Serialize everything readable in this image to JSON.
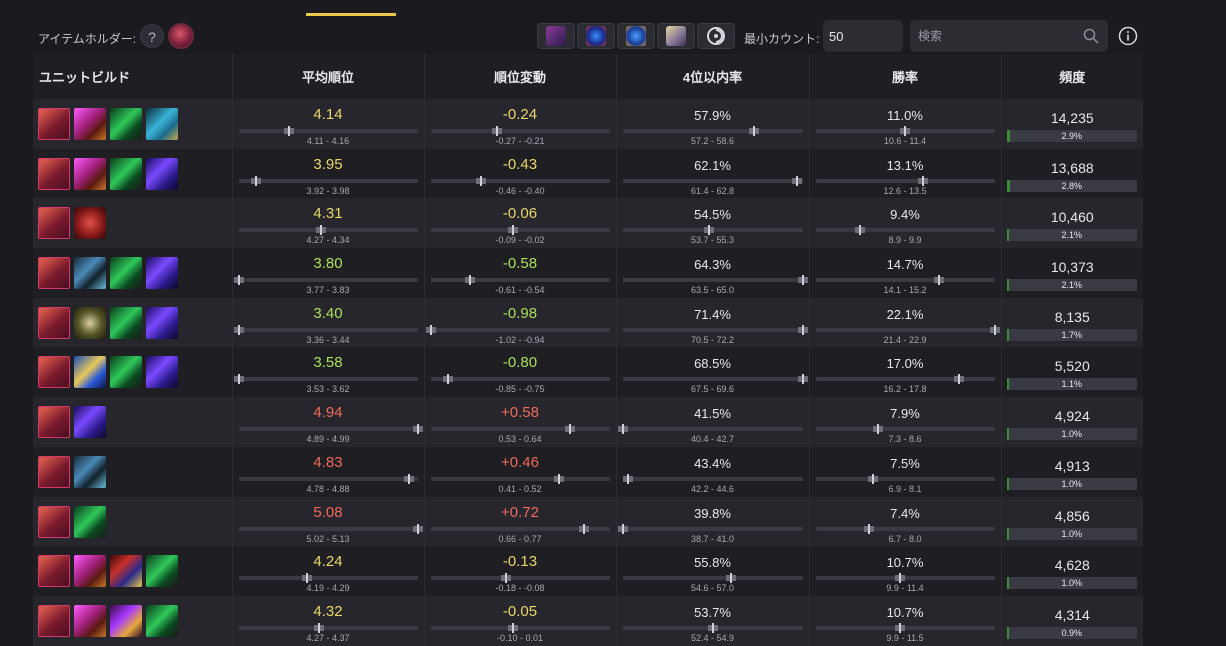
{
  "toolbar": {
    "holder_label": "アイテムホルダー:",
    "unknown_symbol": "?",
    "min_count_label": "最小カウント:",
    "min_count_value": "50",
    "search_placeholder": "検索",
    "filter_icons": [
      "item-icon-1",
      "item-icon-2",
      "item-icon-3",
      "item-icon-4",
      "item-icon-5"
    ]
  },
  "columns": [
    "ユニットビルド",
    "平均順位",
    "順位変動",
    "4位以内率",
    "勝率",
    "頻度"
  ],
  "colors": {
    "good": "#a8e05a",
    "mid": "#e8d86a",
    "bad": "#ef6b5c",
    "accent": "#e8c84a",
    "bar_fill": "#3c8a3c"
  },
  "rows": [
    {
      "items": [
        "item-red-fist",
        "item-green-claw",
        "item-blue-chest"
      ],
      "avg": "4.14",
      "avg_ci": "4.11 - 4.16",
      "avg_tone": "mid",
      "avg_pos": 0.28,
      "delta": "-0.24",
      "delta_ci": "-0.27 - -0.21",
      "delta_tone": "mid",
      "delta_pos": 0.37,
      "top4": "57.9%",
      "top4_ci": "57.2 - 58.6",
      "top4_pos": 0.73,
      "win": "11.0%",
      "win_ci": "10.6 - 11.4",
      "win_pos": 0.5,
      "freq": "14,235",
      "share": "2.9%",
      "share_frac": 0.029
    },
    {
      "items": [
        "item-red-fist",
        "item-green-claw",
        "item-purple-staff"
      ],
      "avg": "3.95",
      "avg_ci": "3.92 - 3.98",
      "avg_tone": "mid",
      "avg_pos": 0.1,
      "delta": "-0.43",
      "delta_ci": "-0.46 - -0.40",
      "delta_tone": "mid",
      "delta_pos": 0.28,
      "top4": "62.1%",
      "top4_ci": "61.4 - 62.8",
      "top4_pos": 0.97,
      "win": "13.1%",
      "win_ci": "12.6 - 13.5",
      "win_pos": 0.6,
      "freq": "13,688",
      "share": "2.8%",
      "share_frac": 0.028
    },
    {
      "items": [
        "item-red-mask"
      ],
      "avg": "4.31",
      "avg_ci": "4.27 - 4.34",
      "avg_tone": "mid",
      "avg_pos": 0.46,
      "delta": "-0.06",
      "delta_ci": "-0.09 - -0.02",
      "delta_tone": "mid",
      "delta_pos": 0.46,
      "top4": "54.5%",
      "top4_ci": "53.7 - 55.3",
      "top4_pos": 0.48,
      "win": "9.4%",
      "win_ci": "8.9 - 9.9",
      "win_pos": 0.25,
      "freq": "10,460",
      "share": "2.1%",
      "share_frac": 0.021
    },
    {
      "items": [
        "item-blue-shard",
        "item-green-claw",
        "item-purple-staff"
      ],
      "avg": "3.80",
      "avg_ci": "3.77 - 3.83",
      "avg_tone": "good",
      "avg_pos": 0.0,
      "delta": "-0.58",
      "delta_ci": "-0.61 - -0.54",
      "delta_tone": "good",
      "delta_pos": 0.22,
      "top4": "64.3%",
      "top4_ci": "63.5 - 65.0",
      "top4_pos": 1.0,
      "win": "14.7%",
      "win_ci": "14.1 - 15.2",
      "win_pos": 0.69,
      "freq": "10,373",
      "share": "2.1%",
      "share_frac": 0.021
    },
    {
      "items": [
        "item-yellow-crescent",
        "item-green-claw",
        "item-purple-staff"
      ],
      "avg": "3.40",
      "avg_ci": "3.36 - 3.44",
      "avg_tone": "good",
      "avg_pos": 0.0,
      "delta": "-0.98",
      "delta_ci": "-1.02 - -0.94",
      "delta_tone": "good",
      "delta_pos": 0.0,
      "top4": "71.4%",
      "top4_ci": "70.5 - 72.2",
      "top4_pos": 1.0,
      "win": "22.1%",
      "win_ci": "21.4 - 22.9",
      "win_pos": 1.0,
      "freq": "8,135",
      "share": "1.7%",
      "share_frac": 0.017
    },
    {
      "items": [
        "item-blue-gold-wing",
        "item-green-claw",
        "item-purple-staff"
      ],
      "avg": "3.58",
      "avg_ci": "3.53 - 3.62",
      "avg_tone": "good",
      "avg_pos": 0.0,
      "delta": "-0.80",
      "delta_ci": "-0.85 - -0.75",
      "delta_tone": "good",
      "delta_pos": 0.1,
      "top4": "68.5%",
      "top4_ci": "67.5 - 69.6",
      "top4_pos": 1.0,
      "win": "17.0%",
      "win_ci": "16.2 - 17.8",
      "win_pos": 0.8,
      "freq": "5,520",
      "share": "1.1%",
      "share_frac": 0.011
    },
    {
      "items": [
        "item-purple-staff"
      ],
      "avg": "4.94",
      "avg_ci": "4.89 - 4.99",
      "avg_tone": "bad",
      "avg_pos": 1.0,
      "delta": "+0.58",
      "delta_ci": "0.53 - 0.64",
      "delta_tone": "bad",
      "delta_pos": 0.78,
      "top4": "41.5%",
      "top4_ci": "40.4 - 42.7",
      "top4_pos": 0.0,
      "win": "7.9%",
      "win_ci": "7.3 - 8.6",
      "win_pos": 0.35,
      "freq": "4,924",
      "share": "1.0%",
      "share_frac": 0.01
    },
    {
      "items": [
        "item-blue-shard"
      ],
      "avg": "4.83",
      "avg_ci": "4.78 - 4.88",
      "avg_tone": "bad",
      "avg_pos": 0.95,
      "delta": "+0.46",
      "delta_ci": "0.41 - 0.52",
      "delta_tone": "bad",
      "delta_pos": 0.72,
      "top4": "43.4%",
      "top4_ci": "42.2 - 44.6",
      "top4_pos": 0.03,
      "win": "7.5%",
      "win_ci": "6.9 - 8.1",
      "win_pos": 0.32,
      "freq": "4,913",
      "share": "1.0%",
      "share_frac": 0.01
    },
    {
      "items": [
        "item-green-claw"
      ],
      "avg": "5.08",
      "avg_ci": "5.02 - 5.13",
      "avg_tone": "bad",
      "avg_pos": 1.0,
      "delta": "+0.72",
      "delta_ci": "0.66 - 0.77",
      "delta_tone": "bad",
      "delta_pos": 0.86,
      "top4": "39.8%",
      "top4_ci": "38.7 - 41.0",
      "top4_pos": 0.0,
      "win": "7.4%",
      "win_ci": "6.7 - 8.0",
      "win_pos": 0.3,
      "freq": "4,856",
      "share": "1.0%",
      "share_frac": 0.01
    },
    {
      "items": [
        "item-red-fist",
        "item-blue-mage-hat",
        "item-green-claw"
      ],
      "avg": "4.24",
      "avg_ci": "4.19 - 4.29",
      "avg_tone": "mid",
      "avg_pos": 0.38,
      "delta": "-0.13",
      "delta_ci": "-0.18 - -0.08",
      "delta_tone": "mid",
      "delta_pos": 0.42,
      "top4": "55.8%",
      "top4_ci": "54.6 - 57.0",
      "top4_pos": 0.6,
      "win": "10.7%",
      "win_ci": "9.9 - 11.4",
      "win_pos": 0.47,
      "freq": "4,628",
      "share": "1.0%",
      "share_frac": 0.01
    },
    {
      "items": [
        "item-red-fist",
        "item-purple-flame-staff",
        "item-green-claw"
      ],
      "avg": "4.32",
      "avg_ci": "4.27 - 4.37",
      "avg_tone": "mid",
      "avg_pos": 0.45,
      "delta": "-0.05",
      "delta_ci": "-0.10 - 0.01",
      "delta_tone": "mid",
      "delta_pos": 0.46,
      "top4": "53.7%",
      "top4_ci": "52.4 - 54.9",
      "top4_pos": 0.5,
      "win": "10.7%",
      "win_ci": "9.9 - 11.5",
      "win_pos": 0.47,
      "freq": "4,314",
      "share": "0.9%",
      "share_frac": 0.009
    }
  ]
}
